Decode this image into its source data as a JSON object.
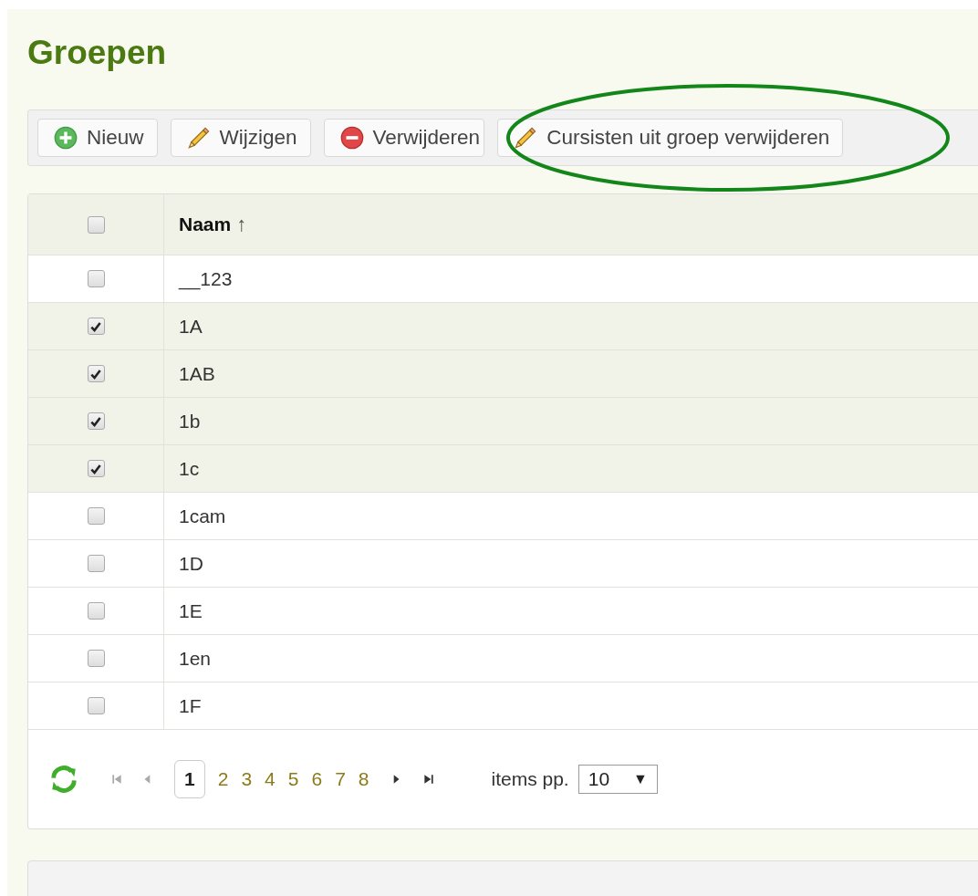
{
  "title": "Groepen",
  "toolbar": [
    {
      "kind": "add",
      "label": "Nieuw"
    },
    {
      "kind": "edit",
      "label": "Wijzigen"
    },
    {
      "kind": "delete",
      "label": "Verwijderen"
    },
    {
      "kind": "edit",
      "label": "Cursisten uit groep verwijderen",
      "highlighted": true
    }
  ],
  "table": {
    "select_all": {
      "checked": false
    },
    "columns": [
      {
        "label": "Naam",
        "sort_arrow": "↑"
      }
    ],
    "rows": [
      {
        "name": "__123",
        "checked": false
      },
      {
        "name": "1A",
        "checked": true
      },
      {
        "name": "1AB",
        "checked": true
      },
      {
        "name": "1b",
        "checked": true
      },
      {
        "name": "1c",
        "checked": true
      },
      {
        "name": "1cam",
        "checked": false
      },
      {
        "name": "1D",
        "checked": false
      },
      {
        "name": "1E",
        "checked": false
      },
      {
        "name": "1en",
        "checked": false
      },
      {
        "name": "1F",
        "checked": false
      }
    ]
  },
  "pager": {
    "pages": [
      {
        "label": "1",
        "selected": true
      },
      {
        "label": "2",
        "selected": false
      },
      {
        "label": "3",
        "selected": false
      },
      {
        "label": "4",
        "selected": false
      },
      {
        "label": "5",
        "selected": false
      },
      {
        "label": "6",
        "selected": false
      },
      {
        "label": "7",
        "selected": false
      },
      {
        "label": "8",
        "selected": false
      }
    ],
    "items_label": "items pp.",
    "items_value": "10",
    "dropdown_arrow": "▼"
  }
}
